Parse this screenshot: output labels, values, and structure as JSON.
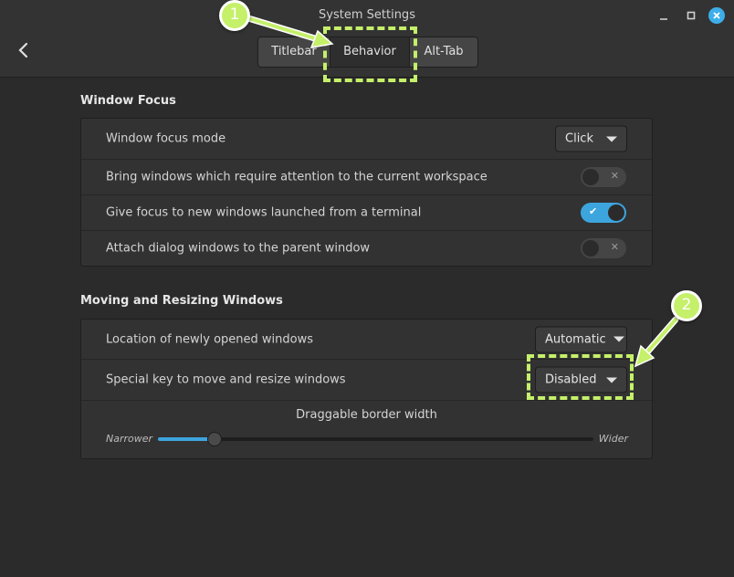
{
  "window": {
    "title": "System Settings",
    "controls": [
      "minimize-icon",
      "maximize-icon",
      "close-icon"
    ]
  },
  "tabs": [
    {
      "label": "Titlebar",
      "active": false
    },
    {
      "label": "Behavior",
      "active": true
    },
    {
      "label": "Alt-Tab",
      "active": false
    }
  ],
  "window_focus": {
    "title": "Window Focus",
    "focus_mode": {
      "label": "Window focus mode",
      "value": "Click"
    },
    "bring_windows": {
      "label": "Bring windows which require attention to the current workspace",
      "enabled": false
    },
    "give_focus": {
      "label": "Give focus to new windows launched from a terminal",
      "enabled": true
    },
    "attach_dialog": {
      "label": "Attach dialog windows to the parent window",
      "enabled": false
    }
  },
  "moving": {
    "title": "Moving and Resizing Windows",
    "location": {
      "label": "Location of newly opened windows",
      "value": "Automatic"
    },
    "special_key": {
      "label": "Special key to move and resize windows",
      "value": "Disabled"
    },
    "border_width": {
      "title": "Draggable border width",
      "min_label": "Narrower",
      "max_label": "Wider",
      "level": 0.13
    }
  },
  "annotations": {
    "badge1": "1",
    "badge2": "2",
    "color": "#c5f06a"
  },
  "colors": {
    "accent": "#3da5de",
    "close_button": "#3daee9"
  }
}
